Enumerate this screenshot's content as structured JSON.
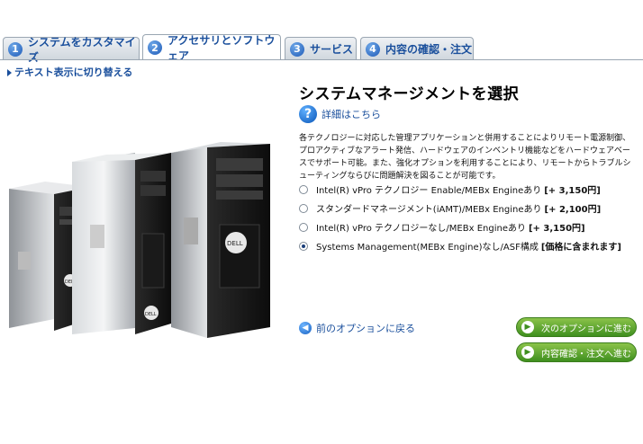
{
  "tabs": [
    {
      "num": "1",
      "label": "システムをカスタマイズ"
    },
    {
      "num": "2",
      "label": "アクセサリとソフトウェア"
    },
    {
      "num": "3",
      "label": "サービス"
    },
    {
      "num": "4",
      "label": "内容の確認・注文"
    }
  ],
  "active_tab": 1,
  "text_view_link": "テキスト表示に切り替える",
  "product_image": {
    "brand_logo": "DELL",
    "description_icon": "desktop-towers-image"
  },
  "section": {
    "title": "システムマネージメントを選択",
    "details_link": "詳細はこちら",
    "details_icon": "question-icon",
    "description": "各テクノロジーに対応した管理アプリケーションと併用することによりリモート電源制御、プロアクティブなアラート発信、ハードウェアのインベントリ機能などをハードウェアベースでサポート可能。また、強化オプションを利用することにより、リモートからトラブルシューティングならびに問題解決を図ることが可能です。"
  },
  "options": [
    {
      "label": "Intel(R) vPro テクノロジー Enable/MEBx Engineあり",
      "price": "[+ 3,150円]",
      "selected": false
    },
    {
      "label": "スタンダードマネージメント(iAMT)/MEBx Engineあり",
      "price": "[+ 2,100円]",
      "selected": false
    },
    {
      "label": "Intel(R) vPro テクノロジーなし/MEBx Engineあり",
      "price": "[+ 3,150円]",
      "selected": false
    },
    {
      "label": "Systems Management(MEBx Engine)なし/ASF構成",
      "price": "[価格に含まれます]",
      "selected": true
    }
  ],
  "nav": {
    "prev_label": "前のオプションに戻る",
    "next_label": "次のオプションに進む",
    "review_label": "内容確認・注文へ進む"
  },
  "colors": {
    "link": "#1a4f9c",
    "button_green": "#5aa52c",
    "tab_number": "#1f5bb8"
  }
}
